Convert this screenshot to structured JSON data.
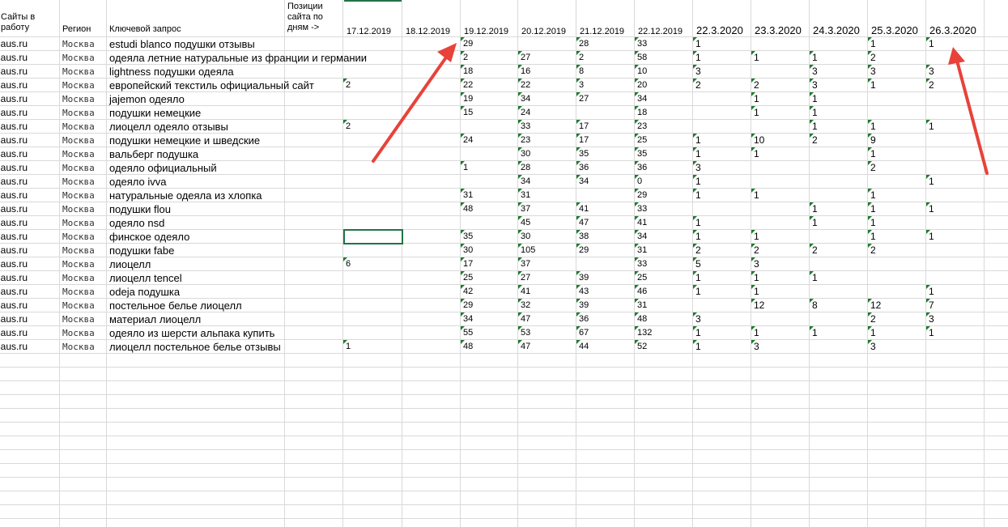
{
  "headers": {
    "sites": "Сайты в работу",
    "region": "Регион",
    "keyword": "Ключевой запрос",
    "positions": "Позиции сайта по дням ->"
  },
  "dates": [
    "17.12.2019",
    "18.12.2019",
    "19.12.2019",
    "20.12.2019",
    "21.12.2019",
    "22.12.2019",
    "22.3.2020",
    "23.3.2020",
    "24.3.2020",
    "25.3.2020",
    "26.3.2020"
  ],
  "site_value": "naus.ru",
  "region_value": "Москва",
  "rows": [
    {
      "kw": "estudi blanco подушки отзывы",
      "v": [
        "",
        "",
        "29",
        "",
        "28",
        "33",
        "1",
        "",
        "",
        "1",
        "1"
      ]
    },
    {
      "kw": "одеяла летние натуральные из франции и германии",
      "v": [
        "",
        "",
        "2",
        "27",
        "2",
        "58",
        "1",
        "1",
        "1",
        "2",
        ""
      ]
    },
    {
      "kw": "lightness подушки одеяла",
      "v": [
        "",
        "",
        "18",
        "16",
        "8",
        "10",
        "3",
        "",
        "3",
        "3",
        "3"
      ]
    },
    {
      "kw": "европейский текстиль официальный сайт",
      "v": [
        "2",
        "",
        "22",
        "22",
        "3",
        "20",
        "2",
        "2",
        "3",
        "1",
        "2"
      ]
    },
    {
      "kw": "jajemon одеяло",
      "v": [
        "",
        "",
        "19",
        "34",
        "27",
        "34",
        "",
        "1",
        "1",
        "",
        ""
      ]
    },
    {
      "kw": "подушки немецкие",
      "v": [
        "",
        "",
        "15",
        "24",
        "",
        "18",
        "",
        "1",
        "1",
        "",
        ""
      ]
    },
    {
      "kw": "лиоцелл одеяло отзывы",
      "v": [
        "2",
        "",
        "",
        "33",
        "17",
        "23",
        "",
        "",
        "1",
        "1",
        "1"
      ]
    },
    {
      "kw": "подушки немецкие и шведские",
      "v": [
        "",
        "",
        "24",
        "23",
        "17",
        "25",
        "1",
        "10",
        "2",
        "9",
        ""
      ]
    },
    {
      "kw": "вальберг подушка",
      "v": [
        "",
        "",
        "",
        "30",
        "35",
        "35",
        "1",
        "1",
        "",
        "1",
        ""
      ]
    },
    {
      "kw": "одеяло официальный",
      "v": [
        "",
        "",
        "1",
        "28",
        "36",
        "36",
        "3",
        "",
        "",
        "2",
        ""
      ]
    },
    {
      "kw": "одеяло ivva",
      "v": [
        "",
        "",
        "",
        "34",
        "34",
        "0",
        "1",
        "",
        "",
        "",
        "1"
      ]
    },
    {
      "kw": "натуральные одеяла из хлопка",
      "v": [
        "",
        "",
        "31",
        "31",
        "",
        "29",
        "1",
        "1",
        "",
        "1",
        ""
      ]
    },
    {
      "kw": "подушки flou",
      "v": [
        "",
        "",
        "48",
        "37",
        "41",
        "33",
        "",
        "",
        "1",
        "1",
        "1"
      ]
    },
    {
      "kw": "одеяло nsd",
      "v": [
        "",
        "",
        "",
        "45",
        "47",
        "41",
        "1",
        "",
        "1",
        "1",
        ""
      ]
    },
    {
      "kw": "финское одеяло",
      "v": [
        "",
        "",
        "35",
        "30",
        "38",
        "34",
        "1",
        "1",
        "",
        "1",
        "1"
      ]
    },
    {
      "kw": "подушки fabe",
      "v": [
        "",
        "",
        "30",
        "105",
        "29",
        "31",
        "2",
        "2",
        "2",
        "2",
        ""
      ]
    },
    {
      "kw": "лиоцелл",
      "v": [
        "6",
        "",
        "17",
        "37",
        "",
        "33",
        "5",
        "3",
        "",
        "",
        ""
      ]
    },
    {
      "kw": "лиоцелл tencel",
      "v": [
        "",
        "",
        "25",
        "27",
        "39",
        "25",
        "1",
        "1",
        "1",
        "",
        ""
      ]
    },
    {
      "kw": "odeja подушка",
      "v": [
        "",
        "",
        "42",
        "41",
        "43",
        "46",
        "1",
        "1",
        "",
        "",
        "1"
      ]
    },
    {
      "kw": "постельное белье лиоцелл",
      "v": [
        "",
        "",
        "29",
        "32",
        "39",
        "31",
        "",
        "12",
        "8",
        "12",
        "7"
      ]
    },
    {
      "kw": "материал лиоцелл",
      "v": [
        "",
        "",
        "34",
        "47",
        "36",
        "48",
        "3",
        "",
        "",
        "2",
        "3"
      ]
    },
    {
      "kw": "одеяло из шерсти альпака купить",
      "v": [
        "",
        "",
        "55",
        "53",
        "67",
        "132",
        "1",
        "1",
        "1",
        "1",
        "1"
      ]
    },
    {
      "kw": "лиоцелл постельное белье отзывы",
      "v": [
        "1",
        "",
        "48",
        "47",
        "44",
        "52",
        "1",
        "3",
        "",
        "3",
        ""
      ]
    }
  ],
  "colors": {
    "grid": "#d9d9d9",
    "triangle": "#1d7b2e",
    "selection": "#217346",
    "arrow": "#e8423a"
  }
}
